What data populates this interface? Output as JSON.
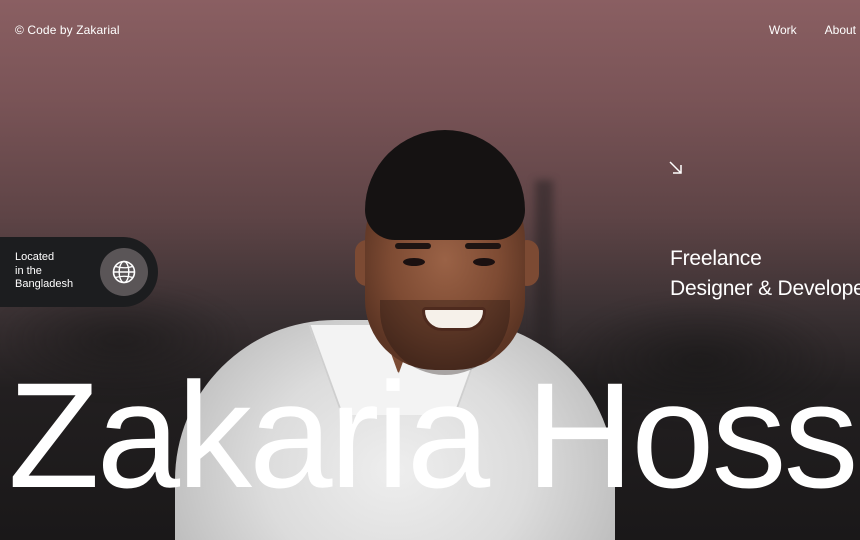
{
  "header": {
    "brand": "© Code by Zakarial",
    "nav": [
      {
        "label": "Work"
      },
      {
        "label": "About"
      }
    ]
  },
  "location": {
    "line1": "Located",
    "line2": "in the",
    "line3": "Bangladesh",
    "icon": "globe-icon"
  },
  "tagline": {
    "arrow_icon": "arrow-down-right-icon",
    "line1": "Freelance",
    "line2": "Designer & Developer"
  },
  "hero": {
    "name": "Zakaria Hossain"
  },
  "colors": {
    "background_top": "#8a5f62",
    "background_bottom": "#1a1819",
    "pill": "#1c1d1f",
    "globe_circle": "#5a5557",
    "text": "#ffffff"
  }
}
